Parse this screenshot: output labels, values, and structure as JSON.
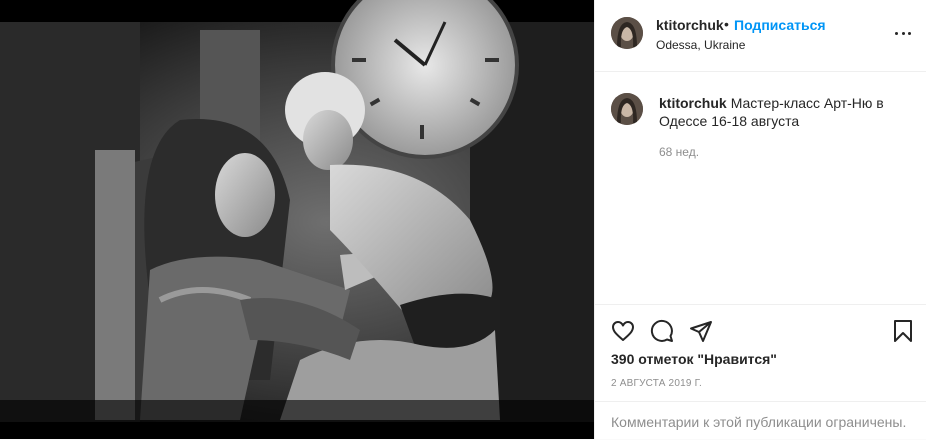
{
  "post": {
    "photo_alt": "black-and-white photo",
    "author": {
      "username": "ktitorchuk",
      "separator": "•",
      "follow_label": "Подписаться",
      "location": "Odessa, Ukraine"
    },
    "caption": {
      "username": "ktitorchuk",
      "text": "Мастер-класс Арт-Ню в Одессе 16-18 августа",
      "time_ago": "68 нед."
    },
    "actions": {
      "like_icon": "heart-icon",
      "comment_icon": "comment-bubble-icon",
      "share_icon": "paper-plane-icon",
      "save_icon": "bookmark-icon"
    },
    "likes_text": "390 отметок \"Нравится\"",
    "date": "2 августа 2019 г.",
    "comments_restricted": "Комментарии к этой публикации ограничены.",
    "colors": {
      "link_blue": "#0095f6",
      "text_primary": "#262626",
      "text_secondary": "#8e8e8e",
      "border": "#efefef"
    }
  }
}
